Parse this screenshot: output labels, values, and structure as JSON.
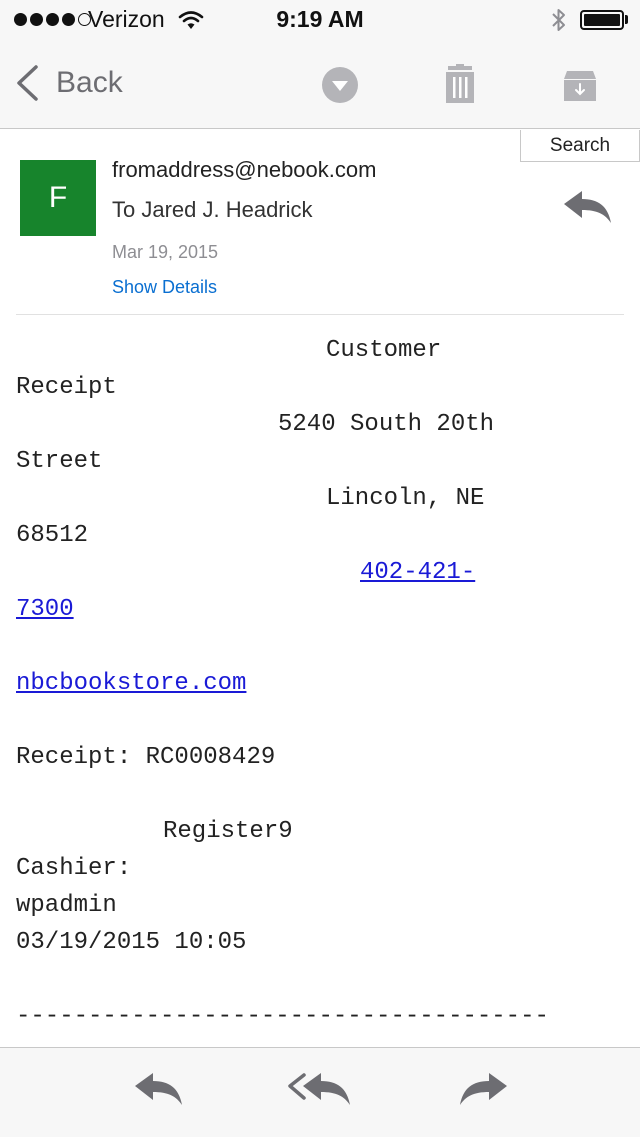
{
  "status_bar": {
    "carrier": "Verizon",
    "time": "9:19 AM"
  },
  "nav": {
    "back_label": "Back"
  },
  "search": {
    "label": "Search"
  },
  "email": {
    "avatar_letter": "F",
    "from": "fromaddress@nebook.com",
    "to": "To Jared J. Headrick",
    "date": "Mar 19, 2015",
    "show_details": "Show Details",
    "body": {
      "title_part1": "Customer",
      "title_part2": "Receipt",
      "street_part1": "5240 South 20th",
      "street_part2": "Street",
      "city": "Lincoln, NE",
      "zip": "68512",
      "phone_part1": "402-421-",
      "phone_part2": "7300",
      "website": "nbcbookstore.com",
      "receipt": "Receipt: RC0008429",
      "register": "Register9",
      "cashier_label": "Cashier:",
      "cashier": "wpadmin",
      "datetime": "03/19/2015 10:05",
      "separator": "-------------------------------------"
    }
  },
  "icons": {
    "status": [
      "signal-dots-icon",
      "wifi-icon",
      "bluetooth-icon",
      "battery-icon"
    ],
    "nav": [
      "chevron-left-icon",
      "chevron-down-circle-icon",
      "trash-icon",
      "archive-icon"
    ],
    "header": [
      "reply-icon"
    ],
    "toolbar": [
      "reply-icon",
      "reply-all-icon",
      "forward-icon"
    ]
  }
}
